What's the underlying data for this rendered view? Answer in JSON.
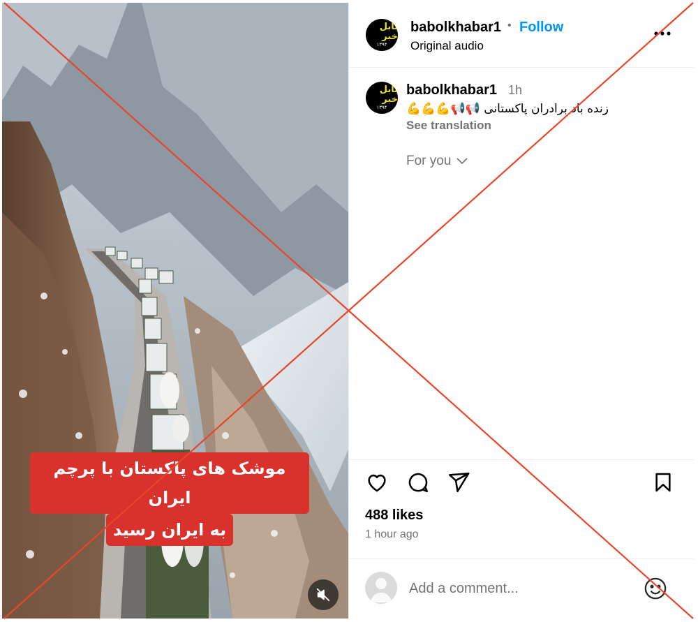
{
  "video": {
    "overlay_line1": "موشک های پاکستان با پرچم ایران",
    "overlay_line2": "به ایران رسید"
  },
  "header": {
    "avatar_logo_top": "بابل خبر",
    "avatar_logo_bottom": "۱۳۹۴",
    "username": "babolkhabar1",
    "dot": "•",
    "follow_label": "Follow",
    "audio_label": "Original audio",
    "more_label": "..."
  },
  "caption": {
    "username": "babolkhabar1",
    "time": "1h",
    "text": "زنده باد برادران پاکستانی 📢📢💪💪💪",
    "see_translation": "See translation",
    "for_you": "For you"
  },
  "stats": {
    "likes": "488 likes",
    "posted": "1 hour ago"
  },
  "comment": {
    "placeholder": "Add a comment..."
  },
  "colors": {
    "follow": "#0095f6",
    "overlay_banner": "#d9312b",
    "cross_lines": "#e8452c",
    "muted_text": "#737373"
  },
  "icons": [
    "mute-icon",
    "more-icon",
    "chevron-down-icon",
    "heart-icon",
    "comment-icon",
    "share-icon",
    "bookmark-icon",
    "user-avatar-icon",
    "emoji-icon"
  ]
}
